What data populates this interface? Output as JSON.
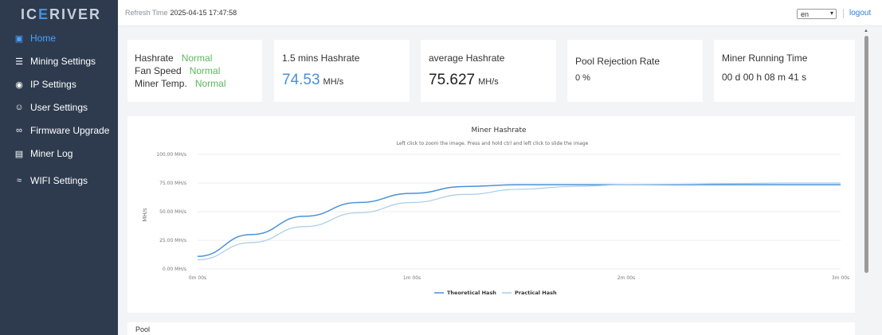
{
  "app": {
    "logo_text_1": "IC",
    "logo_text_accent": "E",
    "logo_text_2": "RIVER"
  },
  "sidebar": {
    "items": [
      {
        "label": "Home",
        "icon": "monitor-icon",
        "glyph": "▣",
        "active": true
      },
      {
        "label": "Mining Settings",
        "icon": "server-icon",
        "glyph": "☰",
        "active": false
      },
      {
        "label": "IP Settings",
        "icon": "location-pin-icon",
        "glyph": "◉",
        "active": false
      },
      {
        "label": "User Settings",
        "icon": "user-icon",
        "glyph": "☺",
        "active": false
      },
      {
        "label": "Firmware Upgrade",
        "icon": "link-icon",
        "glyph": "∞",
        "active": false
      },
      {
        "label": "Miner Log",
        "icon": "log-icon",
        "glyph": "▤",
        "active": false
      },
      {
        "label": "WIFI Settings",
        "icon": "wifi-icon",
        "glyph": "≈",
        "active": false
      }
    ]
  },
  "header": {
    "refresh_label": "Refresh Time",
    "refresh_value": "2025-04-15 17:47:58",
    "language": "en",
    "logout": "logout"
  },
  "status_card": {
    "hashrate_label": "Hashrate",
    "hashrate_status": "Normal",
    "fan_label": "Fan Speed",
    "fan_status": "Normal",
    "temp_label": "Miner Temp.",
    "temp_status": "Normal"
  },
  "cards": {
    "mins_hashrate_title": "1.5 mins Hashrate",
    "mins_hashrate_value": "74.53",
    "mins_hashrate_unit": "MH/s",
    "avg_hashrate_title": "average Hashrate",
    "avg_hashrate_value": "75.627",
    "avg_hashrate_unit": "MH/s",
    "rejection_title": "Pool Rejection Rate",
    "rejection_value": "0 %",
    "runtime_title": "Miner Running Time",
    "runtime_value": "00 d 00 h 08 m 41 s"
  },
  "colors": {
    "theoretical": "#4a90d9",
    "practical": "#a9cbe8",
    "status_ok": "#5cb85c",
    "sidebar_bg": "#2e3b4f"
  },
  "chart_data": {
    "type": "line",
    "title": "Miner Hashrate",
    "subtitle": "Left click to zoom the image. Press and hold ctrl and left click to slide the image",
    "ylabel": "MH/s",
    "ylim": [
      0,
      100
    ],
    "y_ticks": [
      "0.00 MH/s",
      "25.00 MH/s",
      "50.00 MH/s",
      "75.00 MH/s",
      "100.00 MH/s"
    ],
    "y_tick_values": [
      0,
      25,
      50,
      75,
      100
    ],
    "x_ticks": [
      "0m 00s",
      "1m 00s",
      "2m 00s",
      "3m 00s"
    ],
    "x_tick_values": [
      0,
      60,
      120,
      180
    ],
    "xlim": [
      0,
      180
    ],
    "grid": true,
    "legend_position": "bottom",
    "x": [
      0,
      15,
      30,
      45,
      60,
      75,
      90,
      105,
      120,
      135,
      150,
      165,
      180
    ],
    "series": [
      {
        "name": "Theoretical Hash",
        "values": [
          11,
          30,
          46,
          58,
          66,
          72,
          73.5,
          73.5,
          73.5,
          73.5,
          73.5,
          73.5,
          73.5
        ]
      },
      {
        "name": "Practical Hash",
        "values": [
          8,
          23,
          37,
          49,
          58,
          65,
          69.5,
          72,
          73.5,
          74,
          74.5,
          75,
          75
        ]
      }
    ]
  },
  "pool": {
    "title": "Pool"
  }
}
